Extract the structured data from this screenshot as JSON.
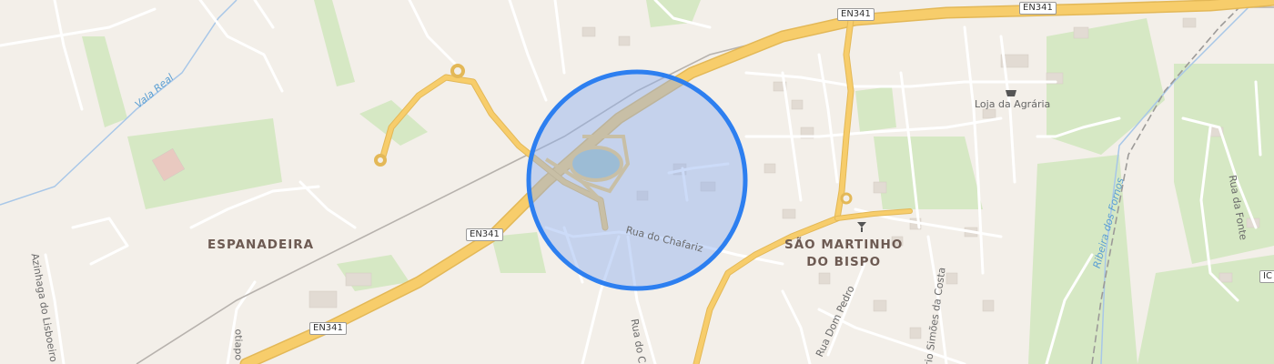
{
  "map": {
    "places": {
      "espanadeira": "ESPANADEIRA",
      "sao_martinho_line1": "SÃO MARTINHO",
      "sao_martinho_line2": "DO BISPO"
    },
    "roads": {
      "rua_do_chafariz": "Rua do Chafariz",
      "rua_do_c": "Rua do C",
      "rua_dom_pedro": "Rua Dom Pedro",
      "rua_simoes_da_costa": "rio Simões da Costa",
      "rua_da_fonte": "Rua da Fonte",
      "azinhaga_do_lisboeiro": "Azinhaga do Lisboeiro",
      "otiapo": "otiapo"
    },
    "route_shields": [
      "EN341",
      "EN341",
      "EN341",
      "EN341"
    ],
    "route_shield_partial": "IC",
    "water": {
      "vala_real": "Vala Real",
      "ribeira": "Ribeira dos Fornos"
    },
    "poi": {
      "loja_da_agraria": "Loja da Agrária"
    },
    "selection": {
      "fill": "#c6d6f6",
      "stroke": "#2d7ff0"
    },
    "colors": {
      "background": "#f3efe9",
      "major_road": "#f7cd6b",
      "minor_road": "#ffffff",
      "park": "#d3e6c0",
      "water": "#a8c7e8",
      "building": "#e0d9d2",
      "rail": "#b5b0ab"
    }
  }
}
